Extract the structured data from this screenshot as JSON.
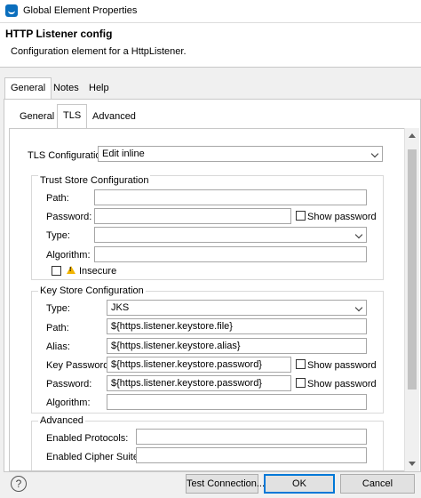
{
  "window": {
    "title": "Global Element Properties"
  },
  "header": {
    "title": "HTTP Listener config",
    "description": "Configuration element for a HttpListener."
  },
  "outer_tabs": [
    {
      "label": "General",
      "active": true
    },
    {
      "label": "Notes",
      "active": false
    },
    {
      "label": "Help",
      "active": false
    }
  ],
  "inner_tabs": [
    {
      "label": "General",
      "active": false
    },
    {
      "label": "TLS",
      "active": true
    },
    {
      "label": "Advanced",
      "active": false
    }
  ],
  "tls": {
    "label": "TLS Configuration",
    "value": "Edit inline"
  },
  "trust_store": {
    "title": "Trust Store Configuration",
    "path_label": "Path:",
    "path_value": "",
    "password_label": "Password:",
    "password_value": "",
    "show_password_label": "Show password",
    "type_label": "Type:",
    "type_value": "",
    "algorithm_label": "Algorithm:",
    "algorithm_value": "",
    "insecure_label": "Insecure"
  },
  "key_store": {
    "title": "Key Store Configuration",
    "type_label": "Type:",
    "type_value": "JKS",
    "path_label": "Path:",
    "path_value": "${https.listener.keystore.file}",
    "alias_label": "Alias:",
    "alias_value": "${https.listener.keystore.alias}",
    "key_password_label": "Key Password:",
    "key_password_value": "${https.listener.keystore.password}",
    "show_key_password_label": "Show password",
    "password_label": "Password:",
    "password_value": "${https.listener.keystore.password}",
    "show_password_label": "Show password",
    "algorithm_label": "Algorithm:",
    "algorithm_value": ""
  },
  "advanced": {
    "title": "Advanced",
    "enabled_protocols_label": "Enabled Protocols:",
    "enabled_protocols_value": "",
    "enabled_cipher_suites_label": "Enabled Cipher Suites:",
    "enabled_cipher_suites_value": ""
  },
  "footer": {
    "help_icon": "?",
    "test_connection_label": "Test Connection...",
    "ok_label": "OK",
    "cancel_label": "Cancel"
  },
  "colors": {
    "accent": "#0078d7",
    "warning": "#f2b400"
  }
}
